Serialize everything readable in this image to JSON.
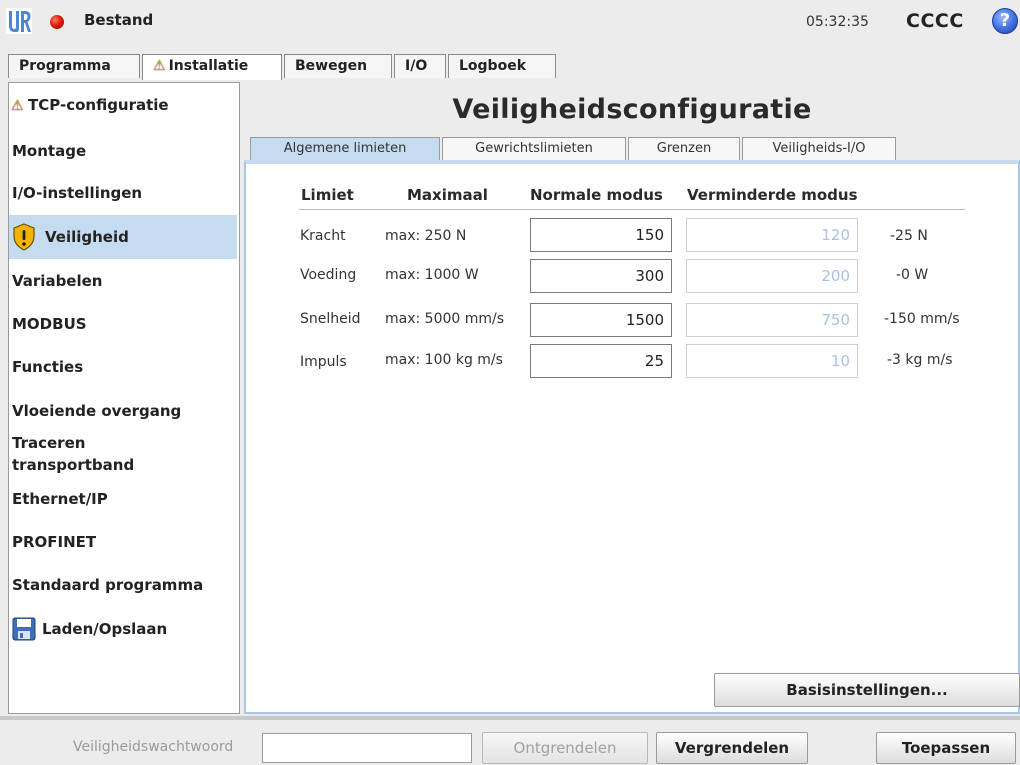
{
  "titlebar": {
    "file_menu": "Bestand",
    "clock": "05:32:35",
    "robot_name": "CCCC",
    "help": "?"
  },
  "main_tabs": [
    {
      "label": "Programma",
      "warning": false
    },
    {
      "label": "Installatie",
      "warning": true
    },
    {
      "label": "Bewegen",
      "warning": false
    },
    {
      "label": "I/O",
      "warning": false
    },
    {
      "label": "Logboek",
      "warning": false
    }
  ],
  "sidebar": {
    "items": [
      {
        "label": "TCP-configuratie"
      },
      {
        "label": "Montage"
      },
      {
        "label": "I/O-instellingen"
      },
      {
        "label": "Veiligheid"
      },
      {
        "label": "Variabelen"
      },
      {
        "label": "MODBUS"
      },
      {
        "label": "Functies"
      },
      {
        "label": "Vloeiende overgang"
      },
      {
        "label": "Traceren transportband",
        "line1": "Traceren",
        "line2": "transportband"
      },
      {
        "label": "Ethernet/IP"
      },
      {
        "label": "PROFINET"
      },
      {
        "label": "Standaard programma"
      },
      {
        "label": "Laden/Opslaan"
      }
    ]
  },
  "content": {
    "title": "Veiligheidsconfiguratie",
    "subtabs": [
      "Algemene limieten",
      "Gewrichtslimieten",
      "Grenzen",
      "Veiligheids-I/O"
    ],
    "columns": {
      "limit": "Limiet",
      "max": "Maximaal",
      "normal": "Normale modus",
      "reduced": "Verminderde modus"
    },
    "rows": [
      {
        "label": "Kracht",
        "max": "max: 250 N",
        "normal": "150",
        "reduced": "120",
        "diff": "-25 N"
      },
      {
        "label": "Voeding",
        "max": "max: 1000 W",
        "normal": "300",
        "reduced": "200",
        "diff": "-0 W"
      },
      {
        "label": "Snelheid",
        "max": "max: 5000 mm/s",
        "normal": "1500",
        "reduced": "750",
        "diff": "-150 mm/s"
      },
      {
        "label": "Impuls",
        "max": "max: 100 kg m/s",
        "normal": "25",
        "reduced": "10",
        "diff": "-3 kg m/s"
      }
    ],
    "basic_settings_button": "Basisinstellingen..."
  },
  "bottombar": {
    "password_label": "Veiligheidswachtwoord",
    "password_value": "",
    "unlock_button": "Ontgrendelen",
    "lock_button": "Vergrendelen",
    "apply_button": "Toepassen"
  }
}
